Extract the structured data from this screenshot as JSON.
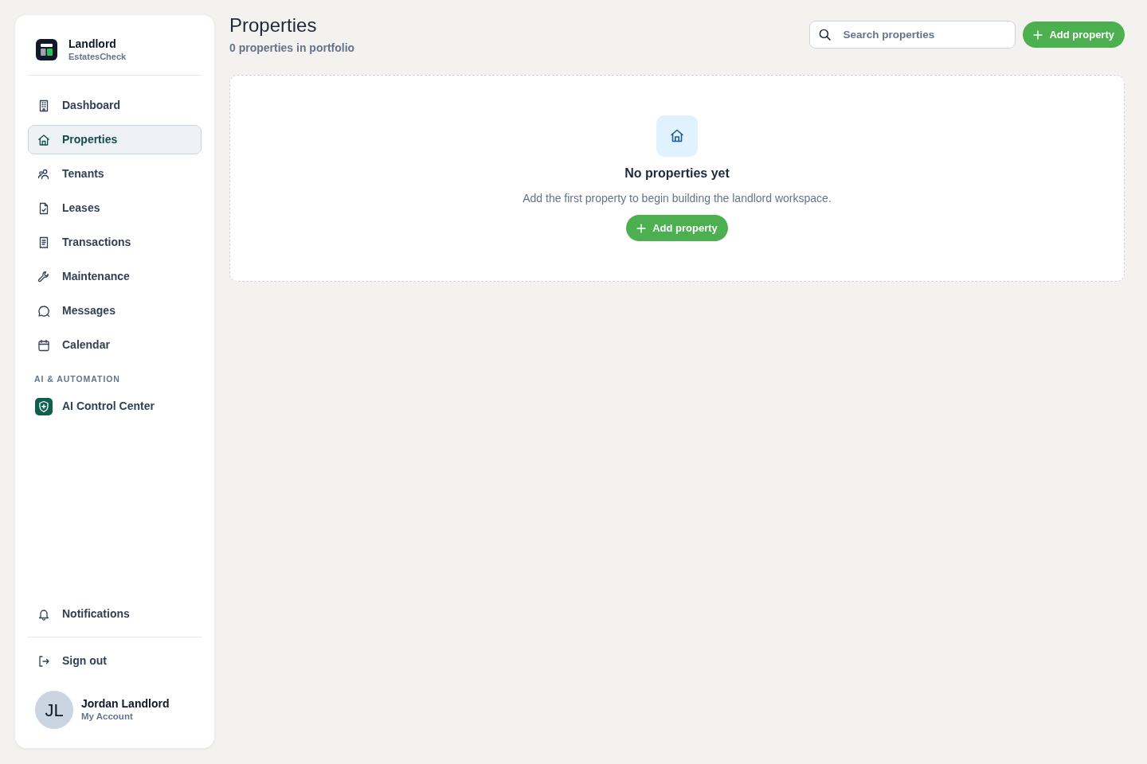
{
  "sidebar": {
    "brand": {
      "title": "Landlord",
      "subtitle": "EstatesCheck"
    },
    "sections": [
      {
        "items": [
          {
            "label": "Dashboard",
            "selected": false
          },
          {
            "label": "Properties",
            "selected": true
          },
          {
            "label": "Tenants",
            "selected": false
          },
          {
            "label": "Leases",
            "selected": false
          },
          {
            "label": "Transactions",
            "selected": false
          },
          {
            "label": "Maintenance",
            "selected": false
          },
          {
            "label": "Messages",
            "selected": false
          },
          {
            "label": "Calendar",
            "selected": false
          }
        ]
      },
      {
        "heading": "AI & AUTOMATION",
        "items": [
          {
            "label": "AI Control Center",
            "selected": false
          }
        ]
      }
    ],
    "notifications": {
      "label": "Notifications",
      "selected": false
    },
    "sign_out": "Sign out",
    "user": {
      "initials": "JL",
      "name": "Jordan Landlord",
      "role": "My Account"
    }
  },
  "header": {
    "title": "Properties",
    "subtitle": "0 properties in portfolio",
    "search": {
      "placeholder": "Search properties"
    },
    "add_button": "Add property"
  },
  "empty_state": {
    "title": "No properties yet",
    "text": "Add the first property to begin building the landlord workspace.",
    "button": "Add property"
  }
}
